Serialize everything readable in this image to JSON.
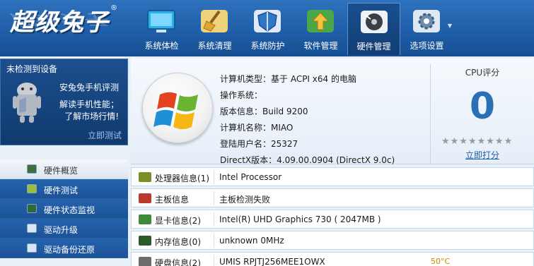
{
  "app": {
    "logo_text": "超级兔子",
    "logo_mark": "®"
  },
  "toolbar": {
    "tabs": [
      {
        "label": "系统体检",
        "icon": "monitor-icon"
      },
      {
        "label": "系统清理",
        "icon": "broom-icon"
      },
      {
        "label": "系统防护",
        "icon": "shield-icon"
      },
      {
        "label": "软件管理",
        "icon": "software-box-icon"
      },
      {
        "label": "硬件管理",
        "icon": "hardware-disc-icon",
        "active": true
      },
      {
        "label": "选项设置",
        "icon": "gear-icon"
      }
    ],
    "dropdown_glyph": "▼"
  },
  "sidebar": {
    "ad": {
      "title": "未检测到设备",
      "line1": "安兔兔手机评测",
      "line2": "解读手机性能；",
      "line3": "了解市场行情!",
      "action": "立即测试",
      "icon": "android-robot-icon"
    },
    "nav": [
      {
        "label": "硬件概览",
        "icon": "monitor-small-icon",
        "active": true
      },
      {
        "label": "硬件测试",
        "icon": "chip-test-icon"
      },
      {
        "label": "硬件状态监视",
        "icon": "status-monitor-icon"
      },
      {
        "label": "驱动升级",
        "icon": "driver-upgrade-icon"
      },
      {
        "label": "驱动备份还原",
        "icon": "driver-backup-icon"
      }
    ]
  },
  "overview": {
    "rows": [
      "计算机类型：基于 ACPI x64 的电脑",
      "操作系统：",
      "版本信息：Build 9200",
      "计算机名称：MIAO",
      "登陆用户名：25327",
      "DirectX版本：4.09.00.0904 (DirectX 9.0c)"
    ],
    "cpu_title": "CPU评分",
    "cpu_score": "0",
    "stars": "★★★★★★★★",
    "rate_link": "立即打分"
  },
  "devices": [
    {
      "label": "处理器信息(1)",
      "value": "Intel Processor",
      "icon": "cpu-chip-icon",
      "color": "#7a8f2a"
    },
    {
      "label": "主板信息",
      "value": "主板检测失败",
      "icon": "motherboard-icon",
      "color": "#b83a2a"
    },
    {
      "label": "显卡信息(2)",
      "value": "Intel(R) UHD Graphics 730 ( 2047MB )",
      "icon": "graphics-card-icon",
      "color": "#3f8a3a"
    },
    {
      "label": "内存信息(0)",
      "value": "unknown 0MHz",
      "icon": "memory-icon",
      "color": "#2d5a2d"
    },
    {
      "label": "硬盘信息(2)",
      "value": "UMIS RPJTJ256MEE1OWX",
      "icon": "harddisk-icon",
      "color": "#6c6c6c",
      "temp": "50°C"
    }
  ]
}
